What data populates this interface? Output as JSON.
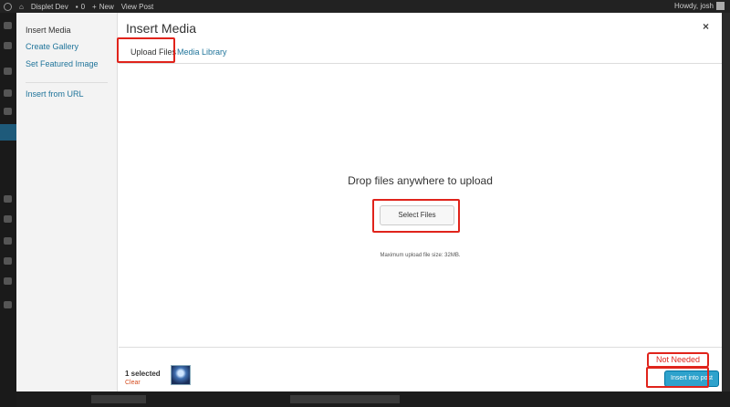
{
  "admin_bar": {
    "site_name": "Displet Dev",
    "comments_count": "0",
    "new_label": "New",
    "view_post_label": "View Post",
    "greeting": "Howdy, josh"
  },
  "modal": {
    "sidebar": {
      "items": [
        {
          "label": "Insert Media"
        },
        {
          "label": "Create Gallery"
        },
        {
          "label": "Set Featured Image"
        },
        {
          "label": "Insert from URL"
        }
      ]
    },
    "title": "Insert Media",
    "close_icon": "×",
    "tabs": [
      {
        "label": "Upload Files"
      },
      {
        "label": "Media Library"
      }
    ],
    "uploader": {
      "drop_text": "Drop files anywhere to upload",
      "button_label": "Select Files",
      "max_size_text": "Maximum upload file size: 32MB."
    },
    "toolbar": {
      "selected_text": "1 selected",
      "clear_label": "Clear",
      "insert_label": "Insert into post"
    }
  },
  "annotation": {
    "note_text": "Not Needed",
    "highlight_color": "#e0231b"
  },
  "colors": {
    "link": "#21759b",
    "primary_button": "#2ea2cc",
    "clear_link": "#d54e21"
  }
}
